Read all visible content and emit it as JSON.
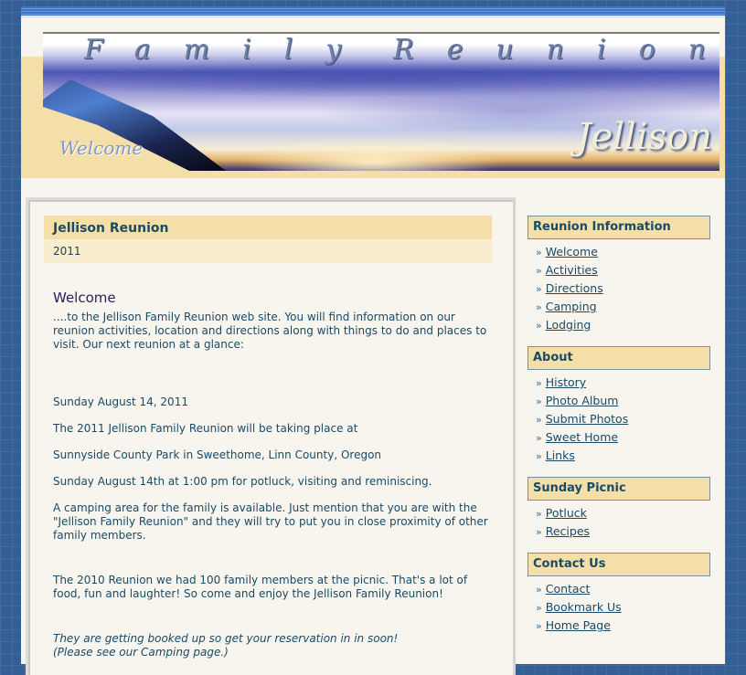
{
  "banner": {
    "title_word_1": "Family",
    "title_word_2": "Reunion",
    "welcome": "Welcome",
    "name": "Jellison"
  },
  "intro": {
    "title": "Jellison Reunion",
    "subtitle": "2011"
  },
  "content": {
    "heading": "Welcome",
    "paragraphs": [
      "....to the Jellison Family Reunion web site. You will find information on our reunion activities, location and directions along with things to do and places to visit. Our next reunion at a glance:",
      "Sunday August 14, 2011",
      "The 2011 Jellison Family Reunion will be taking place at",
      "Sunnyside County Park in Sweethome, Linn County, Oregon",
      "Sunday August 14th at 1:00 pm for potluck, visiting and reminiscing.",
      "A camping area for the family is available. Just mention that you are with the \"Jellison Family Reunion\" and they will try to put you in close proximity of other family members.",
      "The 2010 Reunion we had 100 family members at the picnic. That's a lot of food, fun and laughter! So come and enjoy the Jellison Family Reunion!",
      "They are getting booked up so get your reservation in in soon!",
      "(Please see our Camping page.)"
    ]
  },
  "sidebar": {
    "bullet": "»",
    "sections": [
      {
        "title": "Reunion Information",
        "links": [
          "Welcome",
          "Activities",
          "Directions",
          "Camping",
          "Lodging"
        ]
      },
      {
        "title": "About",
        "links": [
          "History",
          "Photo Album",
          "Submit Photos",
          "Sweet Home",
          "Links"
        ]
      },
      {
        "title": "Sunday Picnic",
        "links": [
          "Potluck",
          "Recipes"
        ]
      },
      {
        "title": "Contact Us",
        "links": [
          "Contact",
          "Bookmark Us",
          "Home Page"
        ]
      }
    ]
  },
  "colors": {
    "background": "#335f96",
    "page": "#f7f5ee",
    "header_band": "#f5dfa8",
    "text": "#1a4a66"
  }
}
